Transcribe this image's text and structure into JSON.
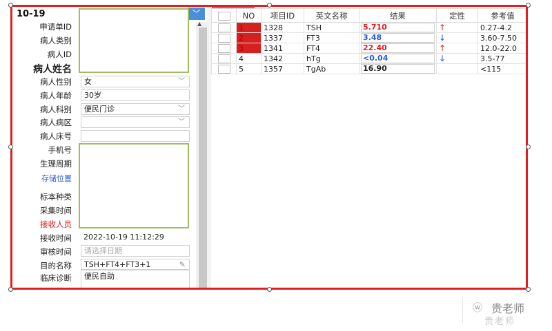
{
  "header": {
    "date": "10-19",
    "dropdown_icon": "chevron-down-icon"
  },
  "form": {
    "labels": {
      "request_id": "申请单ID",
      "patient_type": "病人类别",
      "patient_id": "病人ID",
      "patient_name": "病人姓名",
      "gender": "病人性别",
      "age": "病人年龄",
      "department": "病人科别",
      "ward": "病人病区",
      "bed": "病人床号",
      "phone": "手机号",
      "cycle": "生理周期",
      "storage": "存储位置",
      "specimen": "标本种类",
      "collect_time": "采集时间",
      "receiver": "接收人员",
      "receive_time": "接收时间",
      "review_time": "审核时间",
      "purpose": "目的名称",
      "diagnosis": "临床诊断"
    },
    "values": {
      "gender": "女",
      "age": "30岁",
      "department": "便民门诊",
      "ward": "",
      "bed": "",
      "receive_time": "2022-10-19 11:12:29",
      "purpose": "TSH+FT4+FT3+1",
      "diagnosis": "便民自助"
    },
    "placeholders": {
      "review_time": "请选择日期"
    }
  },
  "grid": {
    "columns": [
      "",
      "NO",
      "项目ID",
      "英文名称",
      "结果",
      "定性",
      "参考值"
    ],
    "rows": [
      {
        "no": "1",
        "id": "1328",
        "name": "TSH",
        "result": "5.710",
        "flag": "↑",
        "ref": "0.27-4.2",
        "result_color": "#e02020",
        "flag_color": "#e02020",
        "no_flag": true
      },
      {
        "no": "2",
        "id": "1337",
        "name": "FT3",
        "result": "3.48",
        "flag": "↓",
        "ref": "3.60-7.50",
        "result_color": "#2a5bd7",
        "flag_color": "#2a5bd7",
        "no_flag": true
      },
      {
        "no": "3",
        "id": "1341",
        "name": "FT4",
        "result": "22.40",
        "flag": "↑",
        "ref": "12.0-22.0",
        "result_color": "#e02020",
        "flag_color": "#e02020",
        "no_flag": true
      },
      {
        "no": "4",
        "id": "1342",
        "name": "hTg",
        "result": "<0.04",
        "flag": "↓",
        "ref": "3.5-77",
        "result_color": "#2a5bd7",
        "flag_color": "#2a5bd7",
        "no_flag": false
      },
      {
        "no": "5",
        "id": "1357",
        "name": "TgAb",
        "result": "16.90",
        "flag": "",
        "ref": "<115",
        "result_color": "#222222",
        "flag_color": "#222222",
        "no_flag": false
      }
    ]
  },
  "watermark": {
    "text": "贵老师",
    "sub": "贵老师"
  }
}
